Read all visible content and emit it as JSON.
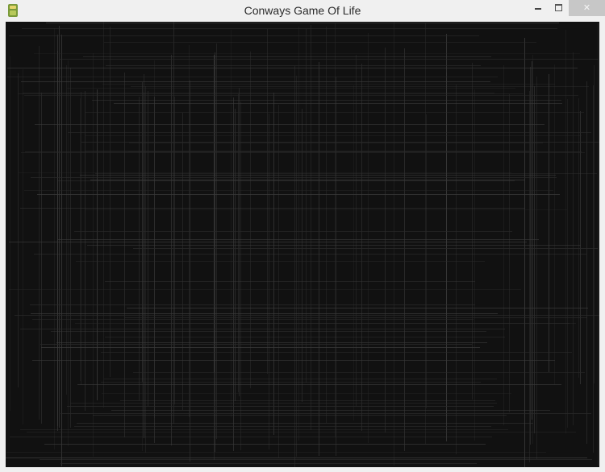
{
  "window": {
    "title": "Conways Game Of Life",
    "close_glyph": "✕",
    "icons": {
      "app": "game-of-life-app-icon",
      "minimize": "minimize-icon",
      "maximize": "maximize-icon",
      "close": "close-icon"
    }
  },
  "colors": {
    "frame": "#f0f0f0",
    "canvas": "#111111",
    "grid_line": "#2a2a2a",
    "grid_line_light": "#3a3a3a",
    "title_text": "#2b2b2b",
    "close_button": "#c7c7c7"
  }
}
